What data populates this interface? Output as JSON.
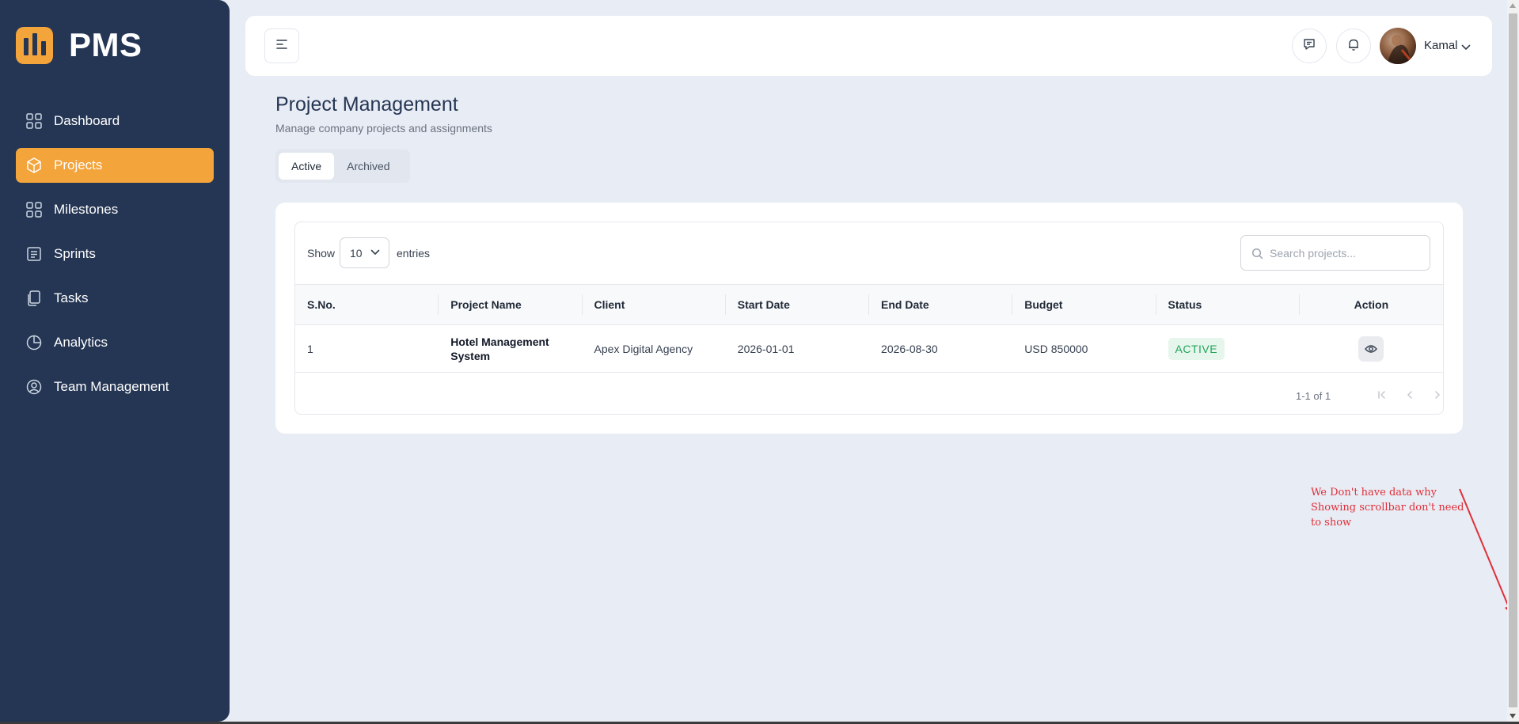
{
  "brand": {
    "name": "PMS",
    "logo_icon": "bar-chart-logo",
    "accent": "#f3a43a"
  },
  "sidebar": {
    "items": [
      {
        "label": "Dashboard",
        "icon": "grid-icon",
        "active": false
      },
      {
        "label": "Projects",
        "icon": "cube-icon",
        "active": true
      },
      {
        "label": "Milestones",
        "icon": "grid-icon",
        "active": false
      },
      {
        "label": "Sprints",
        "icon": "list-icon",
        "active": false
      },
      {
        "label": "Tasks",
        "icon": "copy-icon",
        "active": false
      },
      {
        "label": "Analytics",
        "icon": "pie-chart-icon",
        "active": false
      },
      {
        "label": "Team Management",
        "icon": "user-circle-icon",
        "active": false
      }
    ]
  },
  "topbar": {
    "menu_icon": "menu-left-icon",
    "chat_icon": "message-icon",
    "bell_icon": "bell-icon",
    "user_name": "Kamal"
  },
  "page": {
    "title": "Project Management",
    "subtitle": "Manage company projects and assignments",
    "tabs": [
      {
        "label": "Active",
        "active": true
      },
      {
        "label": "Archived",
        "active": false
      }
    ]
  },
  "table": {
    "show_label": "Show",
    "entries_value": "10",
    "entries_label": "entries",
    "search_placeholder": "Search projects...",
    "columns": [
      "S.No.",
      "Project Name",
      "Client",
      "Start Date",
      "End Date",
      "Budget",
      "Status",
      "Action"
    ],
    "rows": [
      {
        "sno": "1",
        "project_name": "Hotel Management System",
        "client": "Apex Digital Agency",
        "start_date": "2026-01-01",
        "end_date": "2026-08-30",
        "budget": "USD 850000",
        "status": "ACTIVE"
      }
    ],
    "pagination_info": "1-1 of 1"
  },
  "annotation": {
    "text": "We Don't  have data why Showing scrollbar don't need to show",
    "color": "#e0303a"
  }
}
